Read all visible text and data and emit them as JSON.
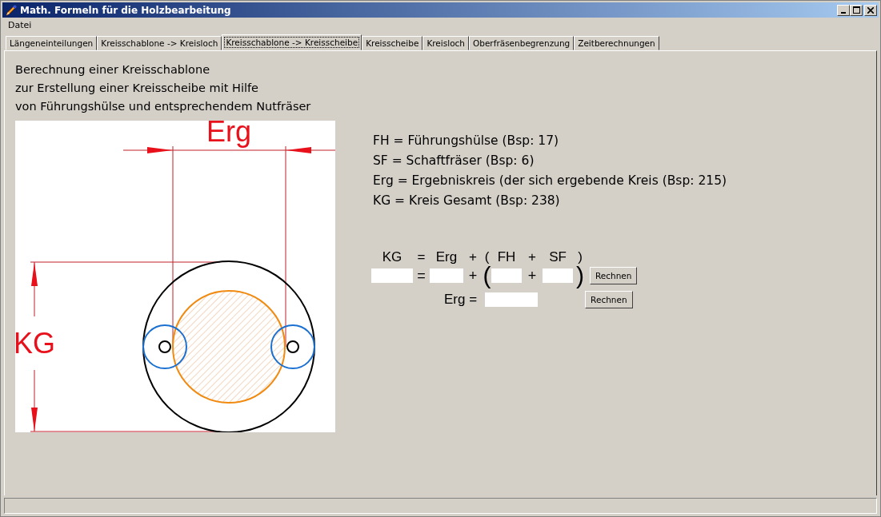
{
  "window": {
    "title": "Math. Formeln für die Holzbearbeitung"
  },
  "menu": [
    "Datei"
  ],
  "tabs": [
    {
      "label": "Längeneinteilungen",
      "selected": false
    },
    {
      "label": "Kreisschablone -> Kreisloch",
      "selected": false
    },
    {
      "label": "Kreisschablone -> Kreisscheibe",
      "selected": true
    },
    {
      "label": "Kreisscheibe",
      "selected": false
    },
    {
      "label": "Kreisloch",
      "selected": false
    },
    {
      "label": "Oberfräsenbegrenzung",
      "selected": false
    },
    {
      "label": "Zeitberechnungen",
      "selected": false
    }
  ],
  "intro": [
    "Berechnung einer Kreisschablone",
    "zur Erstellung einer Kreisscheibe mit Hilfe",
    "von Führungshülse und entsprechendem Nutfräser"
  ],
  "diagram": {
    "width_label": "Erg",
    "height_label": "KG"
  },
  "legend": [
    "FH = Führungshülse (Bsp: 17)",
    "SF = Schaftfräser (Bsp: 6)",
    "Erg = Ergebniskreis (der sich ergebende Kreis (Bsp: 215)",
    "KG = Kreis Gesamt (Bsp: 238)"
  ],
  "formula": {
    "header": [
      "KG",
      "=",
      "Erg",
      "+",
      "(",
      "FH",
      "+",
      "SF",
      ")"
    ],
    "row": [
      {
        "kind": "field"
      },
      {
        "kind": "text",
        "text": "="
      },
      {
        "kind": "field"
      },
      {
        "kind": "text",
        "text": "+"
      },
      {
        "kind": "paren",
        "text": "("
      },
      {
        "kind": "field"
      },
      {
        "kind": "text",
        "text": "+"
      },
      {
        "kind": "field"
      },
      {
        "kind": "paren",
        "text": ")"
      },
      {
        "kind": "button",
        "text": "Rechnen"
      }
    ],
    "result_label": "Erg =",
    "result_button": "Rechnen"
  }
}
